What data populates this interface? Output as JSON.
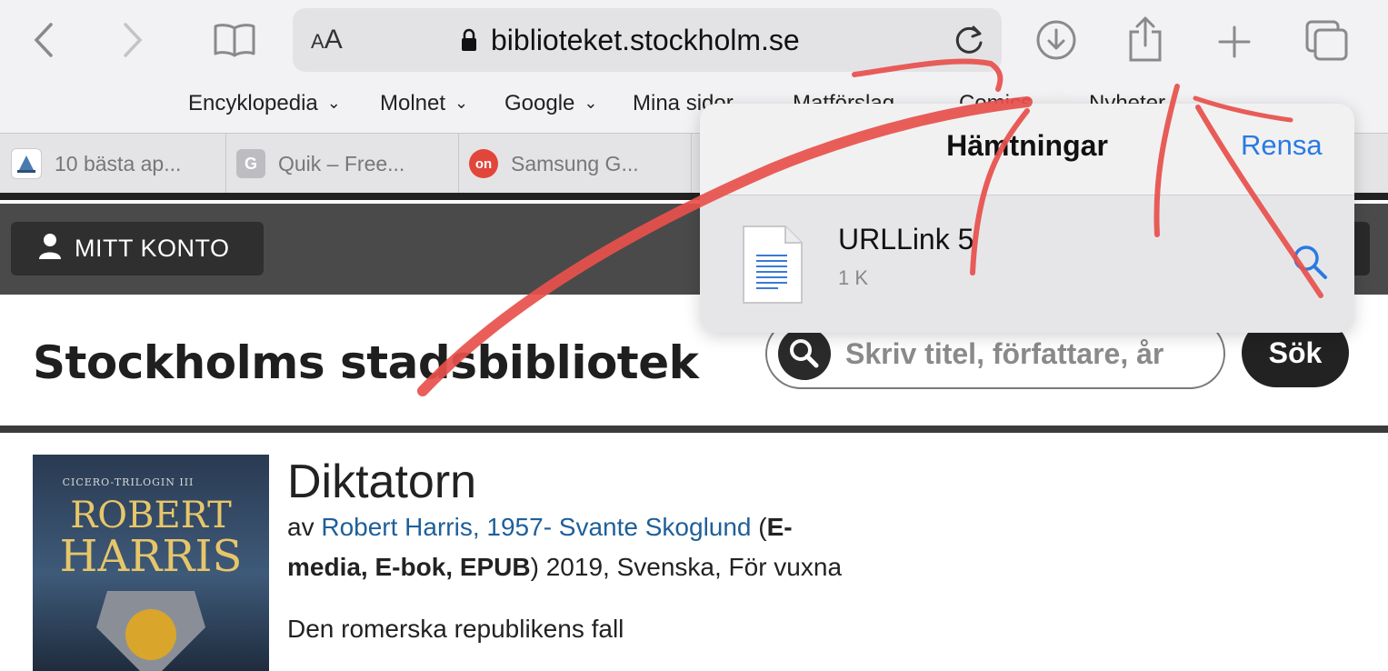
{
  "browser": {
    "text_size_label": "AA",
    "url": "biblioteket.stockholm.se"
  },
  "favorites": [
    {
      "label": "Encyklopedia"
    },
    {
      "label": "Molnet"
    },
    {
      "label": "Google"
    },
    {
      "label": "Mina sidor"
    },
    {
      "label": "Matförslag"
    },
    {
      "label": "Comics"
    },
    {
      "label": "Nyheter"
    }
  ],
  "tabs": [
    {
      "title": "10 bästa ap..."
    },
    {
      "title": "Quik – Free...",
      "favicon": "G"
    },
    {
      "title": "Samsung G...",
      "favicon": "on"
    }
  ],
  "site": {
    "account_button": "MITT KONTO",
    "logo": "Stockholms stadsbibliotek",
    "search_placeholder": "Skriv titel, författare, år",
    "search_button": "Sök"
  },
  "book": {
    "title": "Diktatorn",
    "by": "av",
    "author1": "Robert Harris, 1957-",
    "author2": "Svante Skoglund",
    "open_paren": " (",
    "format_part1": "E-",
    "format_part2": "media, E-bok, EPUB",
    "rest": ") 2019, Svenska, För vuxna",
    "subtitle": "Den romerska republikens fall",
    "cover": {
      "series": "CICERO-TRILOGIN III",
      "author_line1": "ROBERT",
      "author_line2": "HARRIS"
    }
  },
  "downloads": {
    "title": "Hämtningar",
    "clear_label": "Rensa",
    "items": [
      {
        "name": "URLLink 5",
        "size": "1 K"
      }
    ]
  },
  "colors": {
    "link": "#1f5f99",
    "ios_blue": "#2a7ae2",
    "annotation_red": "#e8504c"
  }
}
